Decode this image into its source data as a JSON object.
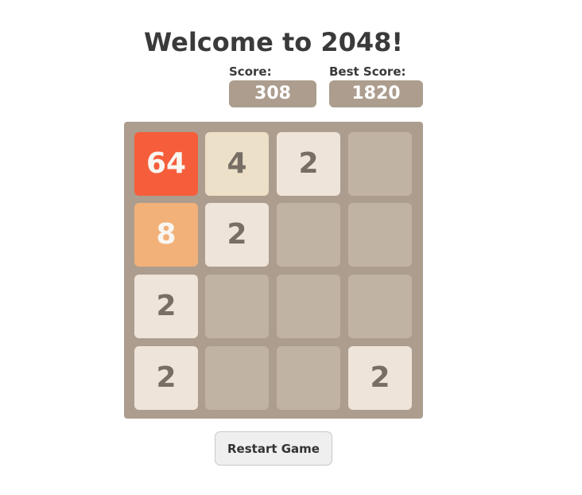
{
  "title": "Welcome to 2048!",
  "score": {
    "label": "Score:",
    "value": "308"
  },
  "best_score": {
    "label": "Best Score:",
    "value": "1820"
  },
  "board": {
    "rows": [
      [
        "64",
        "4",
        "2",
        ""
      ],
      [
        "8",
        "2",
        "",
        ""
      ],
      [
        "2",
        "",
        "",
        ""
      ],
      [
        "2",
        "",
        "",
        "2"
      ]
    ]
  },
  "tile_colors": {
    "empty": "#c1b3a4",
    "2": "#eee4da",
    "4": "#ede0c8",
    "8": "#f2b179",
    "64": "#f65e3b"
  },
  "restart_label": "Restart Game"
}
